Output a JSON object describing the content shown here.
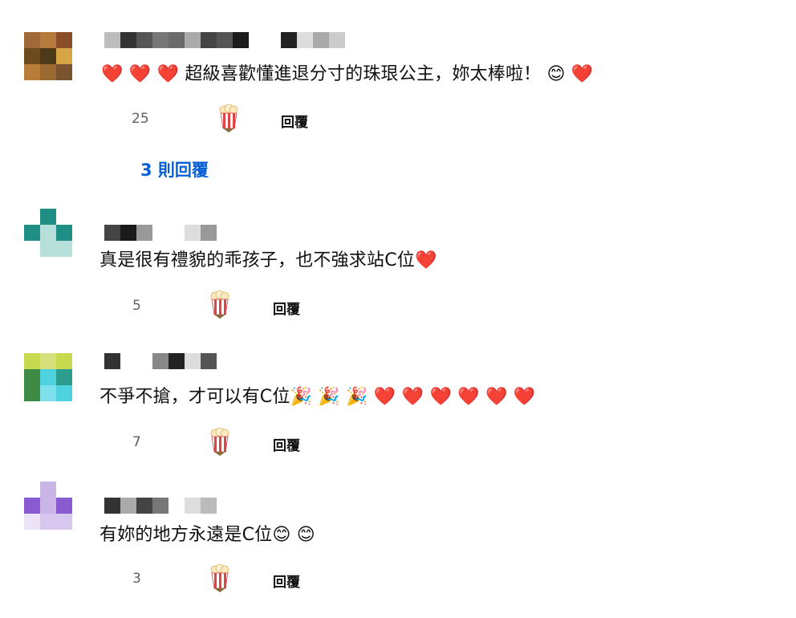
{
  "comments": [
    {
      "text": "❤️ ❤️ ❤️ 超級喜歡懂進退分寸的珠珢公主，妳太棒啦！ 😊 ❤️",
      "likes": "25",
      "reply_label": "回覆",
      "replies_label": "3 則回覆",
      "avatar_colors": [
        "#a0693a",
        "#b57a3c",
        "#8a4f2a",
        "#6e4a1f",
        "#4d3a18",
        "#d9a446",
        "#b97d3a",
        "#9a6a30",
        "#7a5430"
      ]
    },
    {
      "text": "真是很有禮貌的乖孩子，也不強求站C位❤️",
      "likes": "5",
      "reply_label": "回覆",
      "avatar_colors": [
        "#ffffff",
        "#1f8e84",
        "#ffffff",
        "#1f8e84",
        "#b7e0da",
        "#1f8e84",
        "#ffffff",
        "#b7e0da",
        "#b7e0da"
      ]
    },
    {
      "text": "不爭不搶，才可以有C位🎉 🎉 🎉 ❤️ ❤️ ❤️ ❤️ ❤️ ❤️",
      "likes": "7",
      "reply_label": "回覆",
      "avatar_colors": [
        "#c9d94f",
        "#d6e07a",
        "#c9d94f",
        "#3f8a45",
        "#4fd2e0",
        "#2a9d8f",
        "#3f8a45",
        "#7ee0ea",
        "#4fd2e0"
      ]
    },
    {
      "text": "有妳的地方永遠是C位😊 😊",
      "likes": "3",
      "reply_label": "回覆",
      "avatar_colors": [
        "#ffffff",
        "#c9b6e6",
        "#ffffff",
        "#8a5ad0",
        "#c9b6e6",
        "#8a5ad0",
        "#ece4f6",
        "#d7c6ee",
        "#d7c6ee"
      ]
    }
  ],
  "icons": {
    "reaction": "popcorn-icon"
  },
  "colors": {
    "link_blue": "#065fd4",
    "meta_gray": "#606060"
  }
}
